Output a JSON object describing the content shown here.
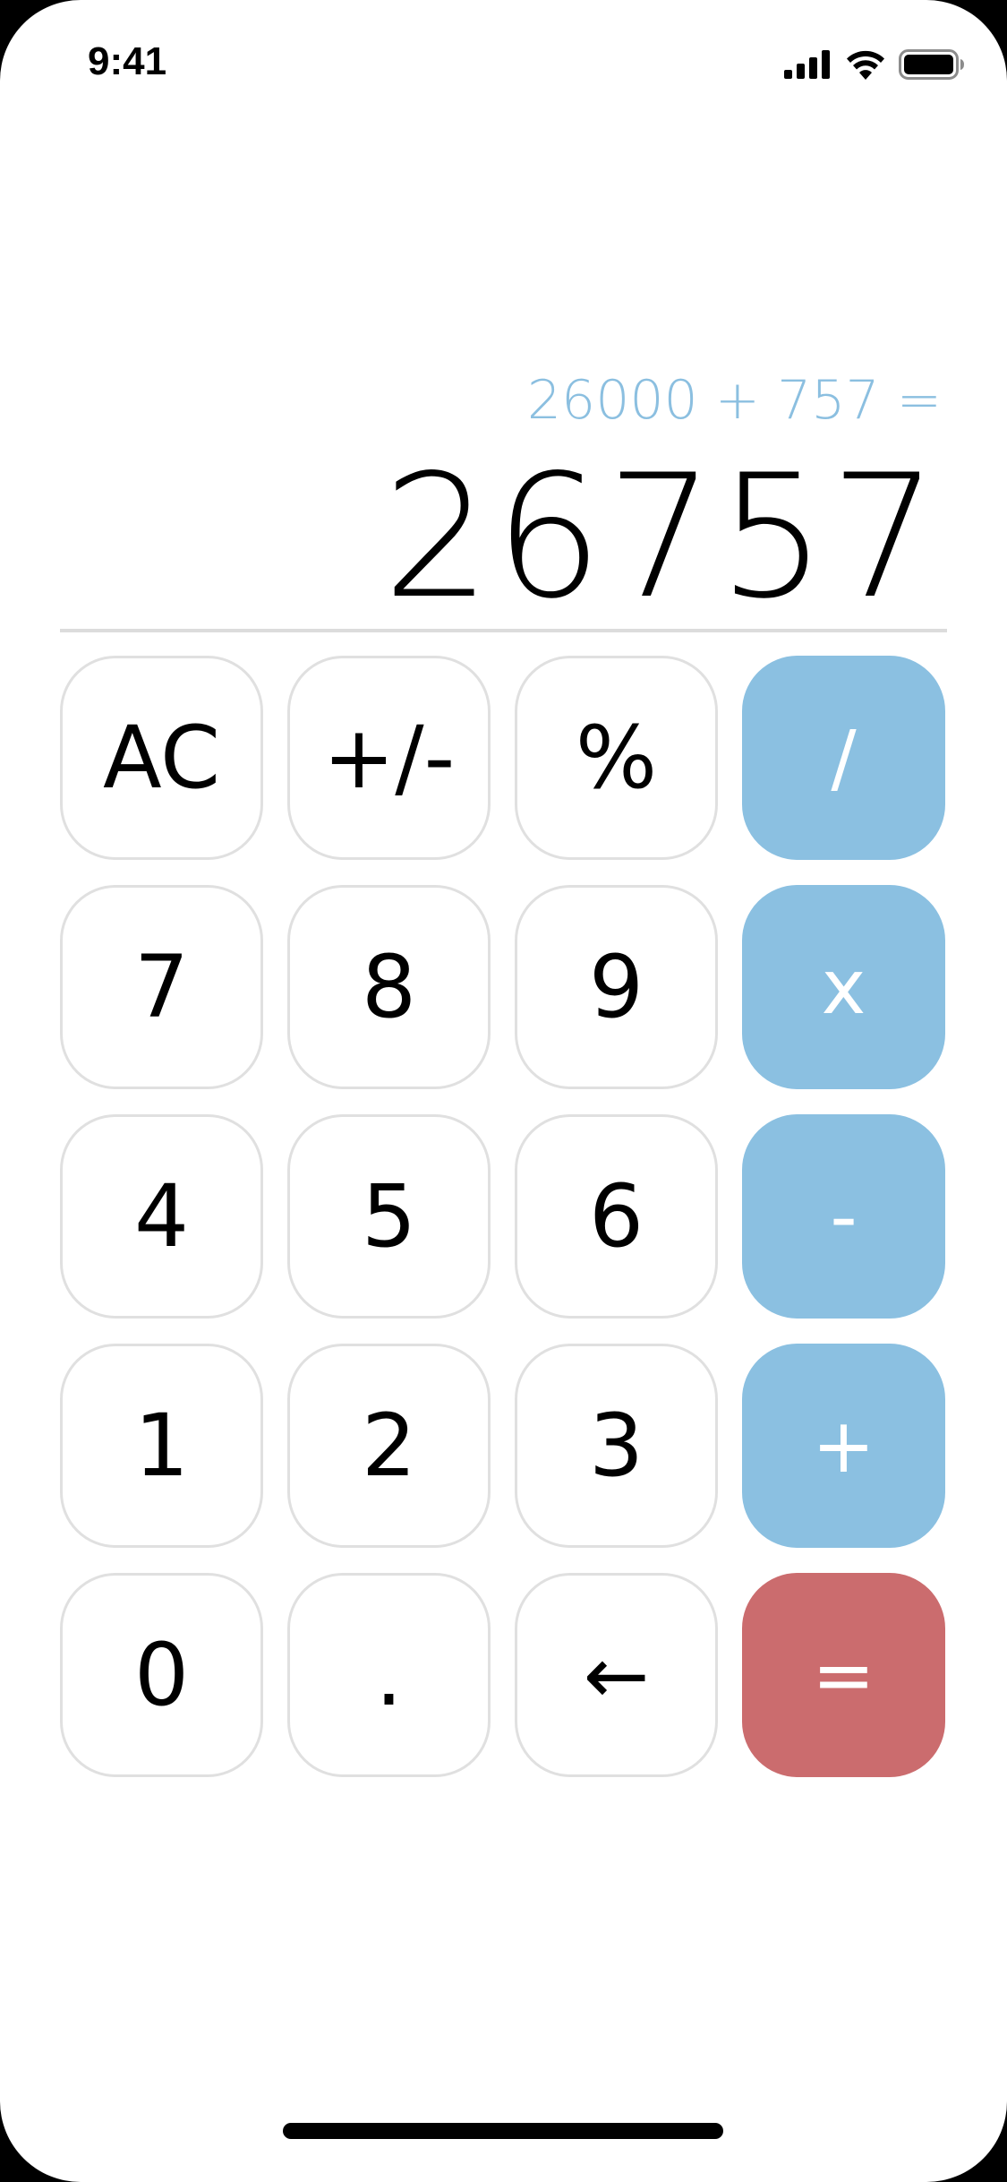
{
  "status_bar": {
    "time": "9:41",
    "icons": [
      "cellular-signal-icon",
      "wifi-icon",
      "battery-icon"
    ]
  },
  "display": {
    "expression": "26000 + 757 =",
    "result": "26757"
  },
  "keypad": {
    "rows": [
      [
        {
          "label": "AC",
          "kind": "function"
        },
        {
          "label": "+/-",
          "kind": "function"
        },
        {
          "label": "%",
          "kind": "function"
        },
        {
          "label": "/",
          "kind": "operator"
        }
      ],
      [
        {
          "label": "7",
          "kind": "digit"
        },
        {
          "label": "8",
          "kind": "digit"
        },
        {
          "label": "9",
          "kind": "digit"
        },
        {
          "label": "x",
          "kind": "operator"
        }
      ],
      [
        {
          "label": "4",
          "kind": "digit"
        },
        {
          "label": "5",
          "kind": "digit"
        },
        {
          "label": "6",
          "kind": "digit"
        },
        {
          "label": "-",
          "kind": "operator"
        }
      ],
      [
        {
          "label": "1",
          "kind": "digit"
        },
        {
          "label": "2",
          "kind": "digit"
        },
        {
          "label": "3",
          "kind": "digit"
        },
        {
          "label": "+",
          "kind": "operator"
        }
      ],
      [
        {
          "label": "0",
          "kind": "digit"
        },
        {
          "label": ".",
          "kind": "digit"
        },
        {
          "label": "←",
          "kind": "function",
          "icon": "backspace-arrow-icon"
        },
        {
          "label": "=",
          "kind": "equals"
        }
      ]
    ]
  },
  "colors": {
    "operator_key": "#8bc0e1",
    "equals_key": "#cb6c6e",
    "expression_text": "#8bbfe0",
    "key_border": "#e0e0e0",
    "divider": "#dcdcdc"
  }
}
